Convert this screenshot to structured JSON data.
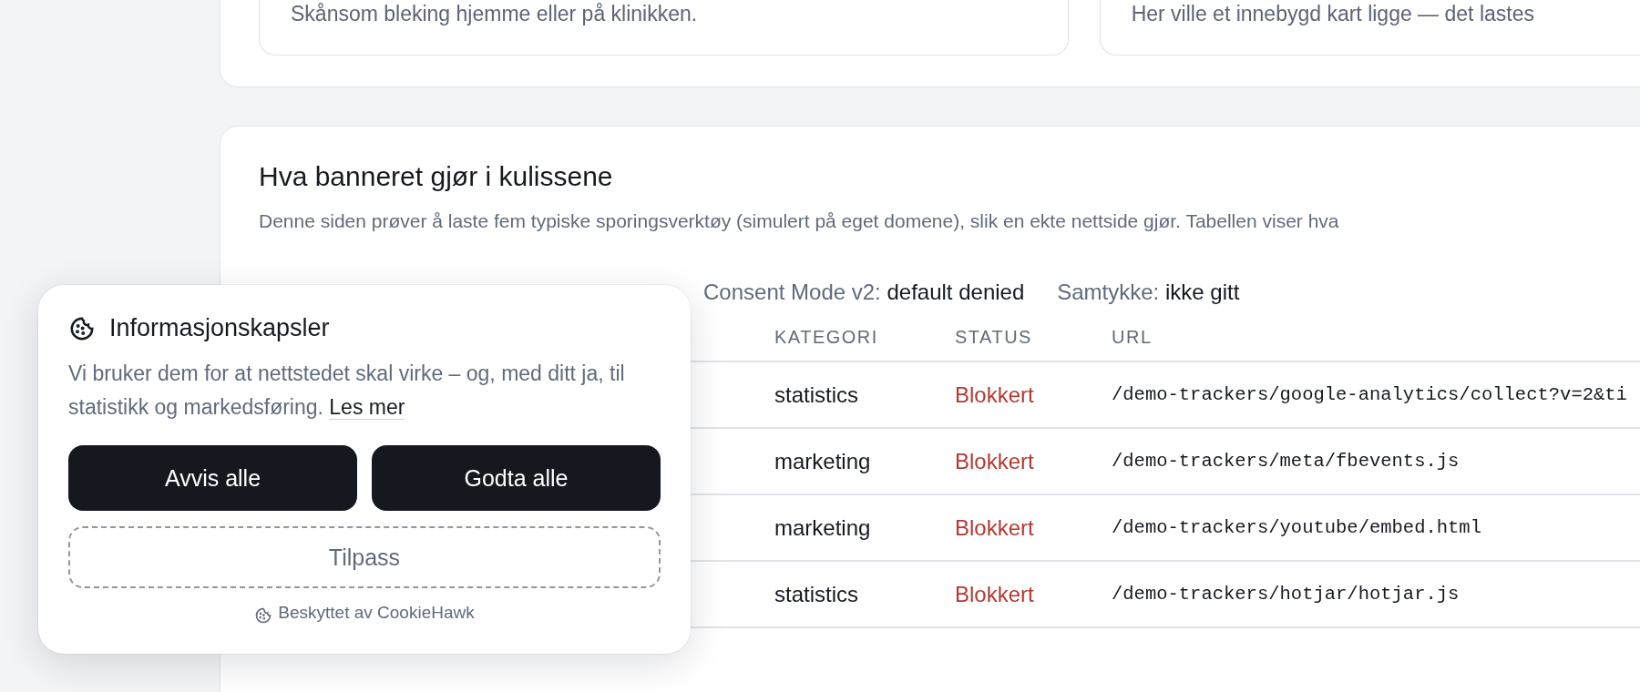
{
  "features": [
    {
      "text": "Skånsom bleking hjemme eller på klinikken."
    },
    {
      "text": "Her ville et innebygd kart ligge — det lastes"
    }
  ],
  "tracker_section": {
    "title": "Hva banneret gjør i kulissene",
    "description": "Denne siden prøver å laste fem typiske sporingsverktøy (simulert på eget domene), slik en ekte nettside gjør. Tabellen viser hva",
    "status_line": [
      {
        "label": "Consent Mode v2:",
        "value": "default denied"
      },
      {
        "label": "Samtykke:",
        "value": "ikke gitt"
      }
    ],
    "table": {
      "columns": [
        "KATEGORI",
        "STATUS",
        "URL"
      ],
      "rows": [
        {
          "category": "statistics",
          "status": "Blokkert",
          "blocked": true,
          "url": "/demo-trackers/google-analytics/collect?v=2&ti"
        },
        {
          "category": "marketing",
          "status": "Blokkert",
          "blocked": true,
          "url": "/demo-trackers/meta/fbevents.js"
        },
        {
          "category": "marketing",
          "status": "Blokkert",
          "blocked": true,
          "url": "/demo-trackers/youtube/embed.html"
        },
        {
          "category": "statistics",
          "status": "Blokkert",
          "blocked": true,
          "url": "/demo-trackers/hotjar/hotjar.js"
        }
      ]
    }
  },
  "cookie_banner": {
    "title": "Informasjonskapsler",
    "text": "Vi bruker dem for at nettstedet skal virke – og, med ditt ja, til statistikk og markedsføring.",
    "link": "Les mer",
    "buttons": [
      {
        "label": "Avvis alle",
        "kind": "primary"
      },
      {
        "label": "Godta alle",
        "kind": "primary"
      },
      {
        "label": "Tilpass",
        "kind": "outline"
      }
    ],
    "footer": "Beskyttet av CookieHawk"
  }
}
